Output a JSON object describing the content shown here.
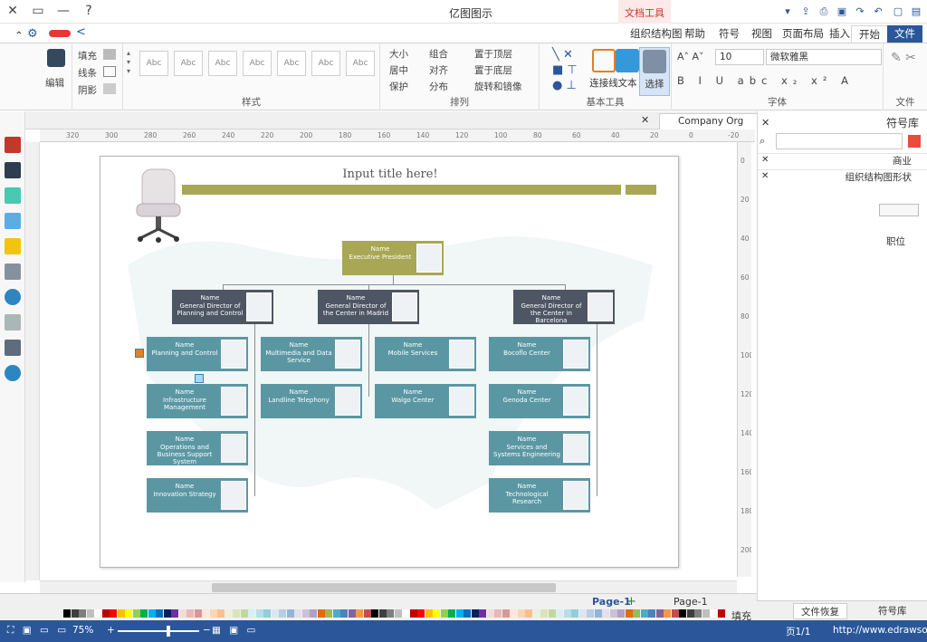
{
  "window": {
    "title": "亿图图示",
    "controls": [
      "✕",
      "▭",
      "—",
      "?"
    ]
  },
  "ribbon": {
    "context_group": "文档工具",
    "tabs": [
      "文件",
      "开始",
      "插入",
      "页面布局",
      "视图",
      "符号",
      "帮助",
      "组织结构图"
    ],
    "active_tab": "开始",
    "groups": {
      "file": {
        "label": "文件"
      },
      "font": {
        "label": "字体",
        "font_family": "微软雅黑",
        "font_size": "10"
      },
      "basic_tools": {
        "label": "基本工具",
        "select_label": "选择",
        "text_label": "文本",
        "connector_label": "连接线"
      },
      "arrange": {
        "label": "排列",
        "items": [
          "置于顶层",
          "置于底层",
          "旋转和镜像",
          "组合",
          "对齐",
          "分布",
          "大小",
          "居中",
          "保护"
        ]
      },
      "styles": {
        "label": "样式",
        "box_label": "Abc",
        "items": [
          "填充",
          "线条",
          "阴影"
        ]
      },
      "edit": {
        "label": "编辑"
      }
    }
  },
  "document": {
    "tab_title": "Company Org Chart",
    "page_title": "Input title here!",
    "h_ruler_ticks": [
      "-20",
      "0",
      "20",
      "40",
      "60",
      "80",
      "100",
      "120",
      "140",
      "160",
      "180",
      "200",
      "220",
      "240",
      "260",
      "280",
      "300",
      "320"
    ],
    "v_ruler_ticks": [
      "0",
      "20",
      "40",
      "60",
      "80",
      "100",
      "120",
      "140",
      "160",
      "180",
      "200"
    ],
    "org": {
      "root": {
        "name": "Name",
        "role": "Executive President"
      },
      "directors": [
        {
          "name": "Name",
          "role": "General Director of the Center in Barcelona"
        },
        {
          "name": "Name",
          "role": "General Director of the Center in Madrid"
        },
        {
          "name": "Name",
          "role": "General Director of Planning and Control"
        }
      ],
      "barcelona": [
        {
          "name": "Name",
          "role": "Bocoflo Center"
        },
        {
          "name": "Name",
          "role": "Genoda Center"
        },
        {
          "name": "Name",
          "role": "Services and Systems Engineering"
        },
        {
          "name": "Name",
          "role": "Technological Research"
        }
      ],
      "madrid_a": [
        {
          "name": "Name",
          "role": "Mobile Services"
        },
        {
          "name": "Name",
          "role": "Walgo Center"
        }
      ],
      "madrid_b": [
        {
          "name": "Name",
          "role": "Multimedia and Data Service"
        },
        {
          "name": "Name",
          "role": "Landline Telephony"
        }
      ],
      "planning": [
        {
          "name": "Name",
          "role": "Planning and Control"
        },
        {
          "name": "Name",
          "role": "Infrastructure Management"
        },
        {
          "name": "Name",
          "role": "Operations and Business Support System"
        },
        {
          "name": "Name",
          "role": "Innovation Strategy"
        }
      ]
    }
  },
  "library": {
    "header": "符号库",
    "items": [
      "商业",
      "组织结构图形状"
    ],
    "shape_label": "职位"
  },
  "page_bar": {
    "page_name": "Page-1",
    "page_tab": "Page-1",
    "fill_label": "填充"
  },
  "bottom_tabs": [
    "符号库",
    "文件恢复"
  ],
  "status": {
    "url": "http://www.edrawsoft.cn/",
    "page_info": "页1/1",
    "zoom": "75%"
  },
  "colors": {
    "accent": "#2b579a",
    "root_card": "#a8a755",
    "director_card": "#4e5563",
    "staff_card": "#5b97a3"
  }
}
